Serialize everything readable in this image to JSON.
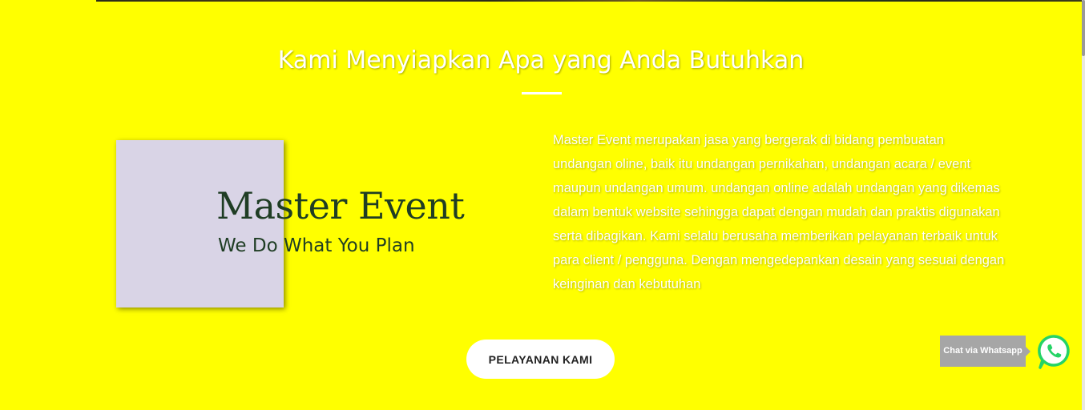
{
  "section": {
    "title": "Kami Menyiapkan Apa yang Anda Butuhkan"
  },
  "logo": {
    "title": "Master Event",
    "tagline": "We Do What You Plan"
  },
  "description": "Master Event merupakan jasa yang bergerak di bidang pembuatan undangan oline, baik itu undangan pernikahan, undangan acara / event maupun undangan umum. undangan online adalah undangan yang dikemas dalam bentuk website sehingga dapat dengan mudah dan praktis digunakan serta dibagikan. Kami selalu berusaha memberikan pelayanan terbaik untuk para client / pengguna. Dengan mengedepankan desain yang sesuai dengan keinginan dan kebutuhan",
  "cta": {
    "label": "PELAYANAN KAMI"
  },
  "whatsapp": {
    "label": "Chat via Whatsapp",
    "icon": "whatsapp-icon",
    "color": "#25d366"
  },
  "colors": {
    "background": "#ffff00",
    "logo_box": "#d9d4e6",
    "logo_text": "#1f3d24"
  }
}
